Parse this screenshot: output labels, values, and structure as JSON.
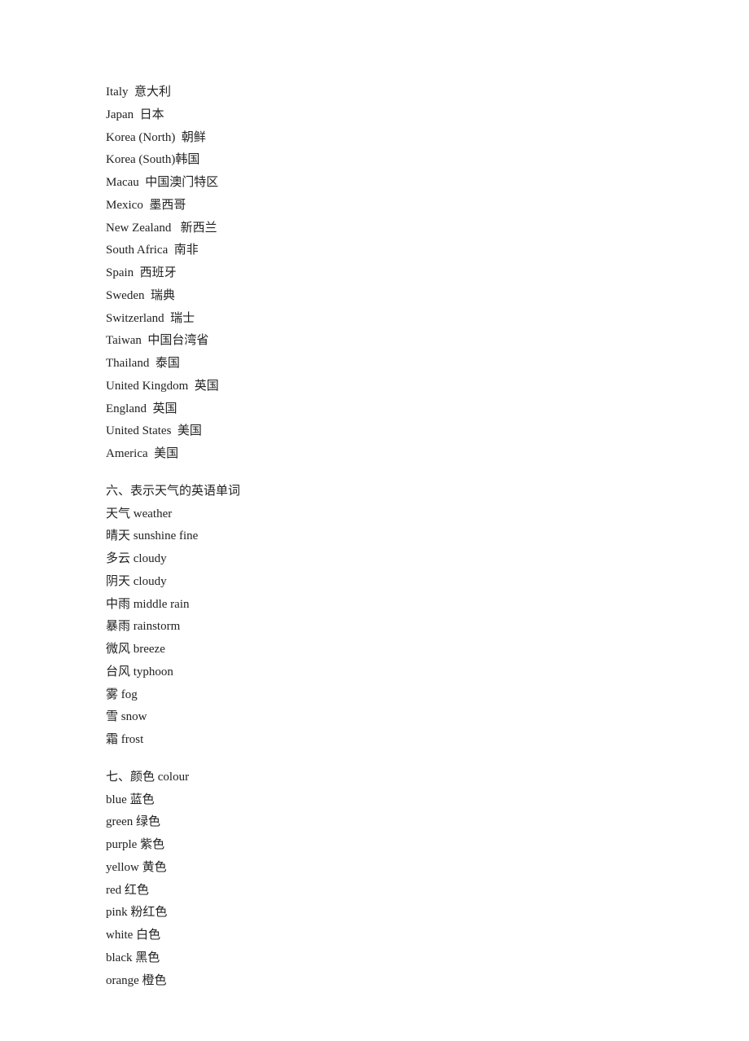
{
  "countries": [
    {
      "line": "Italy  意大利"
    },
    {
      "line": "Japan  日本"
    },
    {
      "line": "Korea (North)  朝鲜"
    },
    {
      "line": "Korea (South)韩国"
    },
    {
      "line": "Macau  中国澳门特区"
    },
    {
      "line": "Mexico  墨西哥"
    },
    {
      "line": "New Zealand   新西兰"
    },
    {
      "line": "South Africa  南非"
    },
    {
      "line": "Spain  西班牙"
    },
    {
      "line": "Sweden  瑞典"
    },
    {
      "line": "Switzerland  瑞士"
    },
    {
      "line": "Taiwan  中国台湾省"
    },
    {
      "line": "Thailand  泰国"
    },
    {
      "line": "United Kingdom  英国"
    },
    {
      "line": "England  英国"
    },
    {
      "line": "United States  美国"
    },
    {
      "line": "America  美国"
    }
  ],
  "section6": {
    "title": "六、表示天气的英语单词",
    "items": [
      {
        "line": "天气 weather"
      },
      {
        "line": "晴天 sunshine fine"
      },
      {
        "line": "多云 cloudy"
      },
      {
        "line": "阴天 cloudy"
      },
      {
        "line": "中雨 middle rain"
      },
      {
        "line": "暴雨 rainstorm"
      },
      {
        "line": "微风 breeze"
      },
      {
        "line": "台风 typhoon"
      },
      {
        "line": "雾 fog"
      },
      {
        "line": "雪 snow"
      },
      {
        "line": "霜 frost"
      }
    ]
  },
  "section7": {
    "title": "七、颜色 colour",
    "items": [
      {
        "line": "blue 蓝色"
      },
      {
        "line": "green 绿色"
      },
      {
        "line": "purple 紫色"
      },
      {
        "line": "yellow 黄色"
      },
      {
        "line": "red 红色"
      },
      {
        "line": "pink 粉红色"
      },
      {
        "line": "white 白色"
      },
      {
        "line": "black 黑色"
      },
      {
        "line": "orange 橙色"
      }
    ]
  }
}
